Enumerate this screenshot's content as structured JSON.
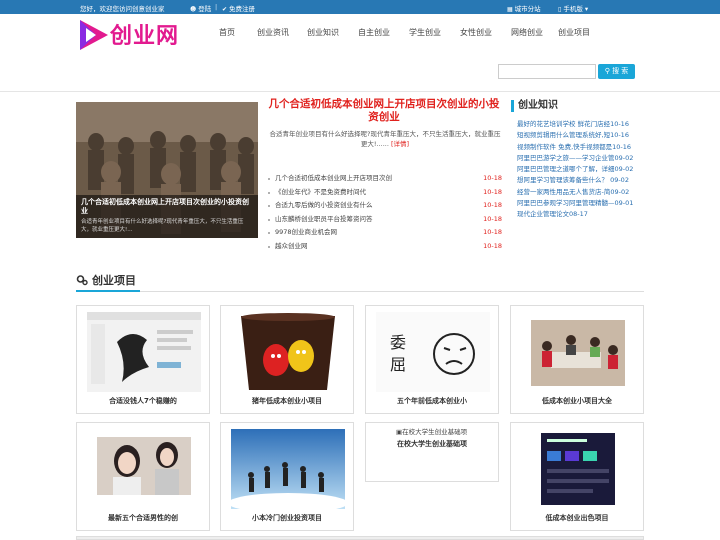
{
  "topbar": {
    "welcome": "您好，欢迎您访问创意创业家",
    "login": "登陆",
    "separator": "|",
    "register": "免费注册",
    "city": "城市分站",
    "mobile": "手机版"
  },
  "header": {
    "logo_text": "创业网",
    "nav": [
      "首页",
      "创业资讯",
      "创业知识",
      "自主创业",
      "学生创业",
      "女性创业",
      "网络创业",
      "创业项目"
    ],
    "search_placeholder": "",
    "search_button": "搜 索"
  },
  "feature": {
    "caption_title": "几个合适初低成本创业网上开店项目次创业的小投资创业",
    "caption_desc": "合适青年创业项目有什么好选择呢?现代青年重压大，不只生活重压大，就业重压更大!...",
    "headline": "几个合适初低成本创业网上开店项目次创业的小投资创业",
    "headline_desc": "合适青年创业项目有什么好选择呢?现代青年重压大，不只生活重压大，就业重压更大!......",
    "detail": "[详情]"
  },
  "news": [
    {
      "title": "几个合适初低成本创业网上开店项目次创",
      "date": "10-18"
    },
    {
      "title": "《创业年代》不是免资费时间代",
      "date": "10-18"
    },
    {
      "title": "合适九零后做的小投资创业有什么",
      "date": "10-18"
    },
    {
      "title": "山东麟桥创业职员平台投筹资问答",
      "date": "10-18"
    },
    {
      "title": "9978创业商业机会网",
      "date": "10-18"
    },
    {
      "title": "越众创业网",
      "date": "10-18"
    }
  ],
  "sidebar": {
    "title": "创业知识",
    "items": [
      "最好的花艺培训学校 鲜花门店经10-16",
      "短视频剪辑用什么管理系统好,短10-16",
      "视频制作软件 免费,快手视频都是10-16",
      "阿里巴巴游学之旅——学习企业管09-02",
      "阿里巴巴管理之道哪个了解，详细09-02",
      "想阿里学习管理该筹备些什么？ 09-02",
      "经营一家两性用品无人售货店-简09-02",
      "阿里巴巴参观学习阿里管理精髓—09-01",
      "现代企业管理论文08-17"
    ]
  },
  "projects": {
    "title": "创业项目",
    "cards": [
      {
        "label": "合适没钱人7个稳赚的"
      },
      {
        "label": "猪年低成本创业小项目"
      },
      {
        "label": "五个年前低成本创业小"
      },
      {
        "label": "低成本创业小项目大全"
      },
      {
        "label": "最新五个合适男性的创"
      },
      {
        "label": "小本冷门创业投资项目"
      },
      {
        "label": "在校大学生创业基础项",
        "broken_alt": "在校大学生创业基础项"
      },
      {
        "label": "低成本创业出色项目"
      }
    ]
  },
  "colors": {
    "topbar": "#2878b4",
    "accent": "#1aa6d8",
    "headline": "#e0211d",
    "logo": "#e21a8f"
  }
}
